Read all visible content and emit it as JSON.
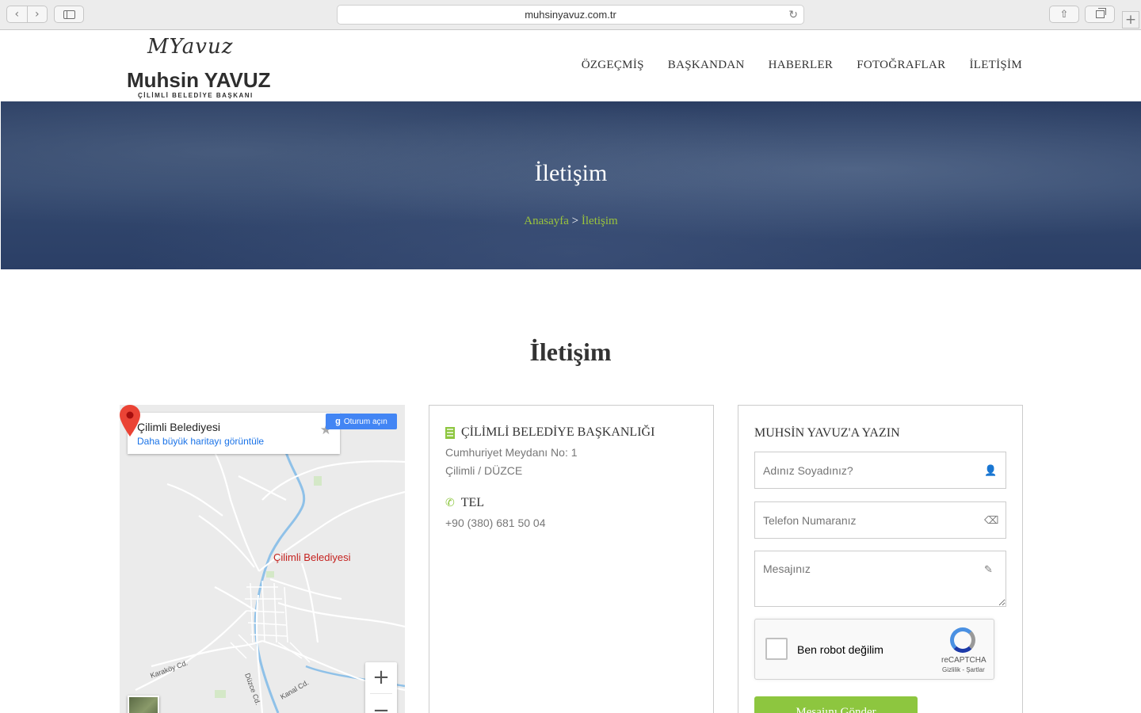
{
  "browser": {
    "url": "muhsinyavuz.com.tr"
  },
  "logo": {
    "script": "MYavuz",
    "name": "Muhsin YAVUZ",
    "subtitle": "ÇİLİMLİ BELEDİYE BAŞKANI"
  },
  "nav": {
    "items": [
      {
        "label": "ÖZGEÇMİŞ"
      },
      {
        "label": "BAŞKANDAN"
      },
      {
        "label": "HABERLER"
      },
      {
        "label": "FOTOĞRAFLAR"
      },
      {
        "label": "İLETİŞİM"
      }
    ]
  },
  "banner": {
    "title": "İletişim",
    "breadcrumb_home": "Anasayfa",
    "breadcrumb_sep": ">",
    "breadcrumb_current": "İletişim"
  },
  "section": {
    "title": "İletişim"
  },
  "map": {
    "place_title": "Çilimli Belediyesi",
    "larger_map_link": "Daha büyük haritayı görüntüle",
    "signin_label": "Oturum açın",
    "marker_label": "Çilimli Belediyesi",
    "road_labels": [
      "Karaköy Cd.",
      "Düzce Cd.",
      "Kanal Cd."
    ]
  },
  "address": {
    "heading": "ÇİLİMLİ BELEDİYE BAŞKANLIĞI",
    "line1": "Cumhuriyet Meydanı No: 1",
    "line2": "Çilimli / DÜZCE",
    "tel_heading": "TEL",
    "phone": "+90 (380) 681 50 04"
  },
  "form": {
    "heading": "MUHSİN YAVUZ'A YAZIN",
    "name_placeholder": "Adınız Soyadınız?",
    "phone_placeholder": "Telefon Numaranız",
    "message_placeholder": "Mesajınız",
    "recaptcha_label": "Ben robot değilim",
    "recaptcha_brand": "reCAPTCHA",
    "recaptcha_terms": "Gizlilik - Şartlar",
    "submit_label": "Mesajını Gönder"
  },
  "colors": {
    "accent_green": "#8dc63f",
    "banner_navy": "#2e4268",
    "link_blue": "#1a73e8",
    "marker_red": "#c5221f"
  }
}
